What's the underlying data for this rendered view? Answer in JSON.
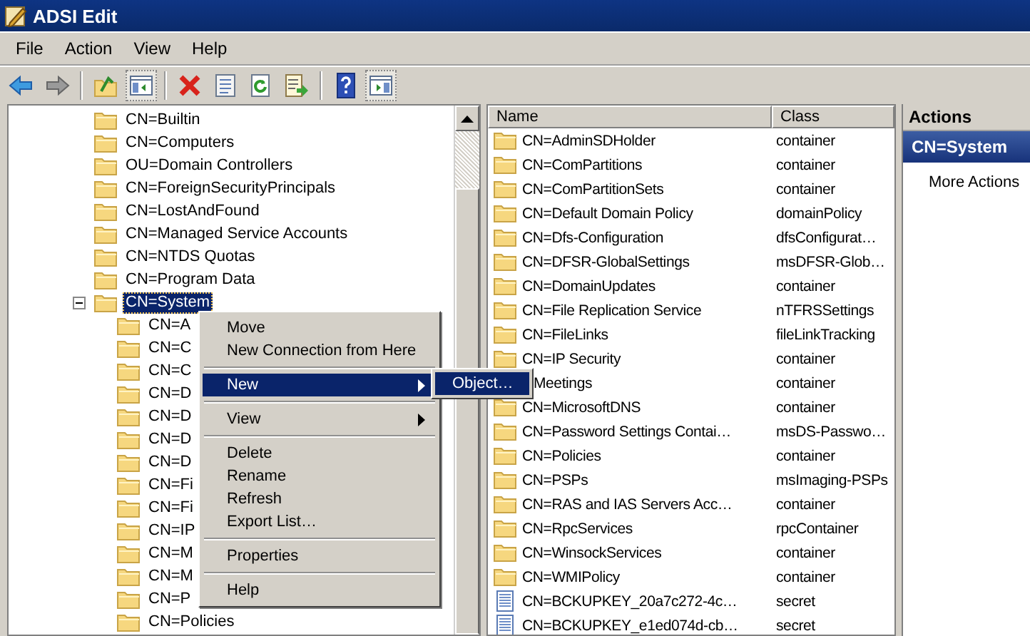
{
  "window": {
    "title": "ADSI Edit"
  },
  "menu_bar": [
    "File",
    "Action",
    "View",
    "Help"
  ],
  "toolbar": [
    {
      "kind": "back",
      "pressed": false
    },
    {
      "kind": "forward",
      "pressed": false
    },
    {
      "kind": "separator"
    },
    {
      "kind": "up",
      "pressed": false
    },
    {
      "kind": "tree",
      "pressed": true
    },
    {
      "kind": "separator"
    },
    {
      "kind": "delete",
      "pressed": false
    },
    {
      "kind": "properties",
      "pressed": false
    },
    {
      "kind": "refresh",
      "pressed": false
    },
    {
      "kind": "export",
      "pressed": false
    },
    {
      "kind": "separator"
    },
    {
      "kind": "help",
      "pressed": false
    },
    {
      "kind": "actionpane",
      "pressed": true
    }
  ],
  "tree": [
    {
      "text": "CN=Builtin",
      "selected": false
    },
    {
      "text": "CN=Computers",
      "selected": false
    },
    {
      "text": "OU=Domain Controllers",
      "selected": false
    },
    {
      "text": "CN=ForeignSecurityPrincipals",
      "selected": false
    },
    {
      "text": "CN=LostAndFound",
      "selected": false
    },
    {
      "text": "CN=Managed Service Accounts",
      "selected": false
    },
    {
      "text": "CN=NTDS Quotas",
      "selected": false
    },
    {
      "text": "CN=Program Data",
      "selected": false
    },
    {
      "text": "CN=System",
      "selected": true,
      "expanded": true,
      "children": [
        {
          "text": "CN=A",
          "selected": false
        },
        {
          "text": "CN=C",
          "selected": false
        },
        {
          "text": "CN=C",
          "selected": false
        },
        {
          "text": "CN=D",
          "selected": false
        },
        {
          "text": "CN=D",
          "selected": false
        },
        {
          "text": "CN=D",
          "selected": false
        },
        {
          "text": "CN=D",
          "selected": false
        },
        {
          "text": "CN=Fi",
          "selected": false
        },
        {
          "text": "CN=Fi",
          "selected": false
        },
        {
          "text": "CN=IP",
          "selected": false
        },
        {
          "text": "CN=M",
          "selected": false
        },
        {
          "text": "CN=M",
          "selected": false
        },
        {
          "text": "CN=P",
          "selected": false
        },
        {
          "text": "CN=Policies",
          "selected": false
        }
      ]
    }
  ],
  "list": {
    "columns": [
      "Name",
      "Class"
    ],
    "rows": [
      {
        "kind": "folder",
        "name": "CN=AdminSDHolder",
        "class": "container"
      },
      {
        "kind": "folder",
        "name": "CN=ComPartitions",
        "class": "container"
      },
      {
        "kind": "folder",
        "name": "CN=ComPartitionSets",
        "class": "container"
      },
      {
        "kind": "folder",
        "name": "CN=Default Domain Policy",
        "class": "domainPolicy"
      },
      {
        "kind": "folder",
        "name": "CN=Dfs-Configuration",
        "class": "dfsConfigurat…"
      },
      {
        "kind": "folder",
        "name": "CN=DFSR-GlobalSettings",
        "class": "msDFSR-Glob…"
      },
      {
        "kind": "folder",
        "name": "CN=DomainUpdates",
        "class": "container"
      },
      {
        "kind": "folder",
        "name": "CN=File Replication Service",
        "class": "nTFRSSettings"
      },
      {
        "kind": "folder",
        "name": "CN=FileLinks",
        "class": "fileLinkTracking"
      },
      {
        "kind": "folder",
        "name": "CN=IP Security",
        "class": "container"
      },
      {
        "kind": "covered",
        "name": "Meetings",
        "class": "container"
      },
      {
        "kind": "folder",
        "name": "CN=MicrosoftDNS",
        "class": "container"
      },
      {
        "kind": "folder",
        "name": "CN=Password Settings Contai…",
        "class": "msDS-Passwo…"
      },
      {
        "kind": "folder",
        "name": "CN=Policies",
        "class": "container"
      },
      {
        "kind": "folder",
        "name": "CN=PSPs",
        "class": "msImaging-PSPs"
      },
      {
        "kind": "folder",
        "name": "CN=RAS and IAS Servers Acc…",
        "class": "container"
      },
      {
        "kind": "folder",
        "name": "CN=RpcServices",
        "class": "rpcContainer"
      },
      {
        "kind": "folder",
        "name": "CN=WinsockServices",
        "class": "container"
      },
      {
        "kind": "folder",
        "name": "CN=WMIPolicy",
        "class": "container"
      },
      {
        "kind": "secret",
        "name": "CN=BCKUPKEY_20a7c272-4c…",
        "class": "secret"
      },
      {
        "kind": "secret",
        "name": "CN=BCKUPKEY_e1ed074d-cb…",
        "class": "secret"
      }
    ]
  },
  "actions": {
    "title": "Actions",
    "section": "CN=System",
    "items": [
      "More Actions"
    ]
  },
  "context_menu": [
    {
      "kind": "item",
      "label": "Move",
      "selected": false,
      "submenu": false
    },
    {
      "kind": "item",
      "label": "New Connection from Here",
      "selected": false,
      "submenu": false
    },
    {
      "kind": "separator"
    },
    {
      "kind": "item",
      "label": "New",
      "selected": true,
      "submenu": true
    },
    {
      "kind": "separator"
    },
    {
      "kind": "item",
      "label": "View",
      "selected": false,
      "submenu": true
    },
    {
      "kind": "separator"
    },
    {
      "kind": "item",
      "label": "Delete",
      "selected": false,
      "submenu": false
    },
    {
      "kind": "item",
      "label": "Rename",
      "selected": false,
      "submenu": false
    },
    {
      "kind": "item",
      "label": "Refresh",
      "selected": false,
      "submenu": false
    },
    {
      "kind": "item",
      "label": "Export List…",
      "selected": false,
      "submenu": false
    },
    {
      "kind": "separator"
    },
    {
      "kind": "item",
      "label": "Properties",
      "selected": false,
      "submenu": false
    },
    {
      "kind": "separator"
    },
    {
      "kind": "item",
      "label": "Help",
      "selected": false,
      "submenu": false
    }
  ],
  "submenu": [
    {
      "label": "Object…",
      "selected": true
    }
  ]
}
